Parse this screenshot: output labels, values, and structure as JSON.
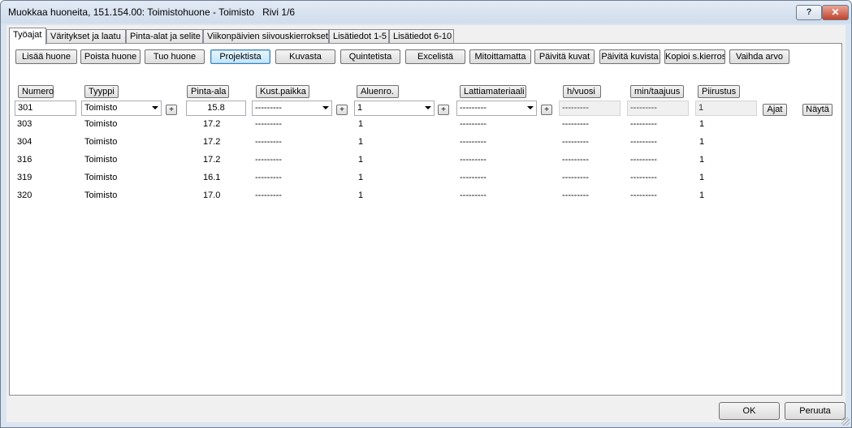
{
  "window": {
    "title": "Muokkaa huoneita, 151.154.00: Toimistohuone - Toimisto   Rivi 1/6",
    "help_label": "?",
    "close_label": "✕"
  },
  "tabs": [
    {
      "label": "Työajat"
    },
    {
      "label": "Väritykset ja laatu"
    },
    {
      "label": "Pinta-alat ja selite"
    },
    {
      "label": "Viikonpäivien siivouskierrokset"
    },
    {
      "label": "Lisätiedot 1-5"
    },
    {
      "label": "Lisätiedot 6-10"
    }
  ],
  "toolbar": [
    {
      "label": "Lisää huone"
    },
    {
      "label": "Poista huone"
    },
    {
      "label": "Tuo huone"
    },
    {
      "label": "Projektista"
    },
    {
      "label": "Kuvasta"
    },
    {
      "label": "Quintetista"
    },
    {
      "label": "Excelistä"
    },
    {
      "label": "Mitoittamatta"
    },
    {
      "label": "Päivitä kuvat"
    },
    {
      "label": "Päivitä kuvista"
    },
    {
      "label": "Kopioi s.kierros"
    },
    {
      "label": "Vaihda arvo"
    }
  ],
  "columns": [
    {
      "label": "Numero"
    },
    {
      "label": "Tyyppi"
    },
    {
      "label": "Pinta-ala"
    },
    {
      "label": "Kust.paikka"
    },
    {
      "label": "Aluenro."
    },
    {
      "label": "Lattiamateriaali"
    },
    {
      "label": "h/vuosi"
    },
    {
      "label": "min/taajuus"
    },
    {
      "label": "Piirustus"
    }
  ],
  "edit_row": {
    "numero": "301",
    "tyyppi": "Toimisto",
    "pinta_ala": "15.8",
    "kust_paikka": "---------",
    "aluenro": "1",
    "lattiamateriaali": "---------",
    "h_vuosi": "---------",
    "min_taajuus": "---------",
    "piirustus": "1",
    "plus_label": "+",
    "ajat_label": "Ajat",
    "nayta_label": "Näytä"
  },
  "rows": [
    {
      "numero": "303",
      "tyyppi": "Toimisto",
      "pinta_ala": "17.2",
      "kust_paikka": "---------",
      "aluenro": "1",
      "lattiamateriaali": "---------",
      "h_vuosi": "---------",
      "min_taajuus": "---------",
      "piirustus": "1"
    },
    {
      "numero": "304",
      "tyyppi": "Toimisto",
      "pinta_ala": "17.2",
      "kust_paikka": "---------",
      "aluenro": "1",
      "lattiamateriaali": "---------",
      "h_vuosi": "---------",
      "min_taajuus": "---------",
      "piirustus": "1"
    },
    {
      "numero": "316",
      "tyyppi": "Toimisto",
      "pinta_ala": "17.2",
      "kust_paikka": "---------",
      "aluenro": "1",
      "lattiamateriaali": "---------",
      "h_vuosi": "---------",
      "min_taajuus": "---------",
      "piirustus": "1"
    },
    {
      "numero": "319",
      "tyyppi": "Toimisto",
      "pinta_ala": "16.1",
      "kust_paikka": "---------",
      "aluenro": "1",
      "lattiamateriaali": "---------",
      "h_vuosi": "---------",
      "min_taajuus": "---------",
      "piirustus": "1"
    },
    {
      "numero": "320",
      "tyyppi": "Toimisto",
      "pinta_ala": "17.0",
      "kust_paikka": "---------",
      "aluenro": "1",
      "lattiamateriaali": "---------",
      "h_vuosi": "---------",
      "min_taajuus": "---------",
      "piirustus": "1"
    }
  ],
  "footer": {
    "ok_label": "OK",
    "cancel_label": "Peruuta"
  }
}
